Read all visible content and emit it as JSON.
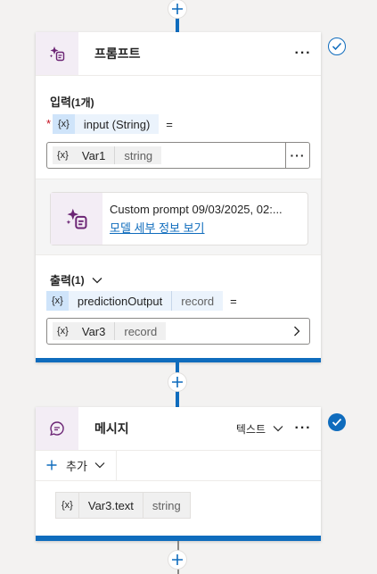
{
  "prompt_node": {
    "title": "프롬프트",
    "more_label": "···",
    "input_section": {
      "label": "입력",
      "count": "(1개)",
      "required_marker": "*",
      "var_badge": "{x}",
      "param_name": "input (String)",
      "equals": "=",
      "value": {
        "badge": "{x}",
        "name": "Var1",
        "type": "string",
        "more_label": "···"
      }
    },
    "custom_prompt": {
      "title": "Custom prompt 09/03/2025, 02:...",
      "link": "모델 세부 정보 보기"
    },
    "output_section": {
      "label": "출력",
      "count": "(1)",
      "var_badge": "{x}",
      "param_name": "predictionOutput",
      "param_type": "record",
      "equals": "=",
      "value": {
        "badge": "{x}",
        "name": "Var3",
        "type": "record"
      }
    }
  },
  "message_node": {
    "title": "메시지",
    "type_selector": "텍스트",
    "more_label": "···",
    "add_label": "추가",
    "value": {
      "badge": "{x}",
      "name": "Var3.text",
      "type": "string"
    }
  },
  "colors": {
    "accent": "#0f6cbd",
    "status_ok": "#0f6cbd",
    "icon_purple": "#6b2474"
  }
}
